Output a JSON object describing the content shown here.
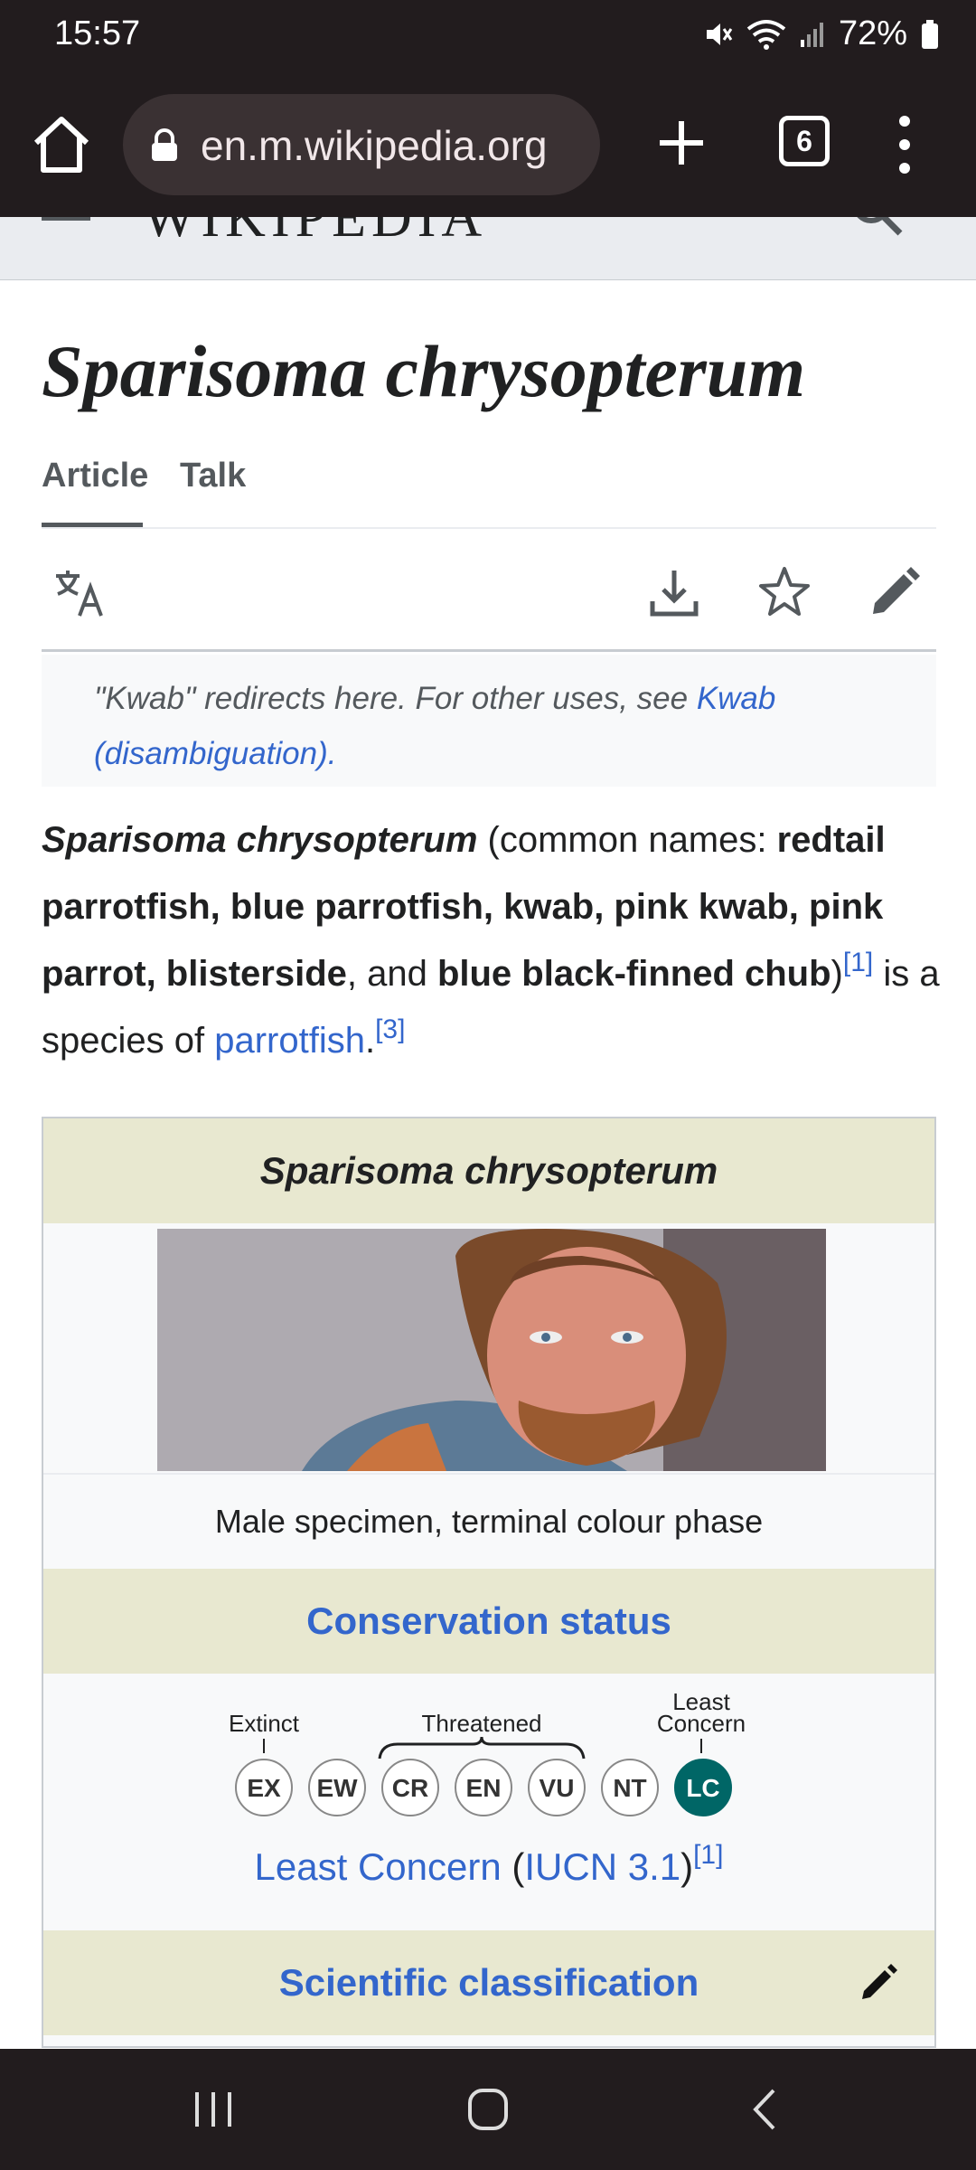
{
  "status_bar": {
    "time": "15:57",
    "battery": "72%"
  },
  "browser": {
    "url": "en.m.wikipedia.org",
    "tab_count": "6"
  },
  "wiki_header": {
    "wordmark": "WIKIPEDIA"
  },
  "page": {
    "title": "Sparisoma chrysopterum",
    "tabs": [
      {
        "label": "Article"
      },
      {
        "label": "Talk"
      }
    ],
    "hatnote": {
      "text": "\"Kwab\" redirects here. For other uses, see ",
      "link": "Kwab (disambiguation)",
      "end": "."
    },
    "lead": {
      "name": "Sparisoma chrysopterum",
      "open": " (common names: ",
      "common_names": "redtail parrotfish, blue parrotfish, kwab, pink kwab, pink parrot, blisterside",
      "and": ", and ",
      "last_name": "blue black-finned chub",
      "close": ")",
      "ref1": "[1]",
      "mid": " is a species of ",
      "link": "parrotfish",
      "dot": ".",
      "ref3": "[3]"
    }
  },
  "infobox": {
    "title": "Sparisoma chrysopterum",
    "caption": "Male specimen, terminal colour phase",
    "conservation_heading": "Conservation status",
    "iucn_labels": {
      "extinct": "Extinct",
      "threatened": "Threatened",
      "least1": "Least",
      "least2": "Concern"
    },
    "iucn_categories": [
      "EX",
      "EW",
      "CR",
      "EN",
      "VU",
      "NT",
      "LC"
    ],
    "status_link": "Least Concern",
    "status_open": " (",
    "status_system": "IUCN 3.1",
    "status_close": ")",
    "status_ref": "[1]",
    "classification_heading": "Scientific classification"
  },
  "colors": {
    "link": "#3366cc",
    "infobox_header": "#e8e8d0",
    "lc_badge": "#006666",
    "chrome": "#221c1e"
  }
}
